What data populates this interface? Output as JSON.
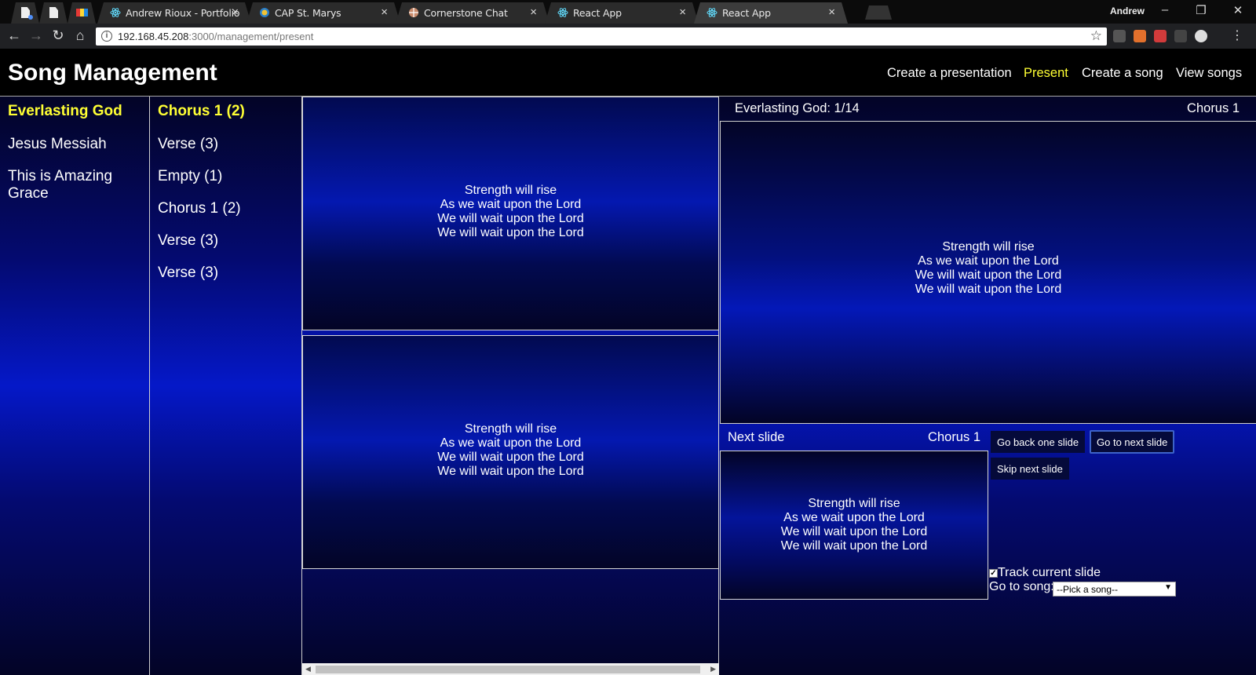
{
  "browser": {
    "tabs": [
      {
        "title": "Andrew Rioux - Portfolio",
        "close": "×"
      },
      {
        "title": "CAP St. Marys",
        "close": "×"
      },
      {
        "title": "Cornerstone Chat",
        "close": "×"
      },
      {
        "title": "React App",
        "close": "×"
      },
      {
        "title": "React App",
        "close": "×"
      }
    ],
    "profile_name": "Andrew",
    "url_host": "192.168.45.208",
    "url_path": ":3000/management/present"
  },
  "app": {
    "title": "Song Management",
    "nav": [
      {
        "label": "Create a presentation"
      },
      {
        "label": "Present",
        "active": true
      },
      {
        "label": "Create a song"
      },
      {
        "label": "View songs"
      }
    ]
  },
  "songs": [
    {
      "label": "Everlasting God",
      "active": true
    },
    {
      "label": "Jesus Messiah"
    },
    {
      "label": "This is Amazing Grace"
    }
  ],
  "sections": [
    {
      "label": "Chorus 1 (2)",
      "active": true
    },
    {
      "label": "Verse (3)"
    },
    {
      "label": "Empty (1)"
    },
    {
      "label": "Chorus 1 (2)"
    },
    {
      "label": "Verse (3)"
    },
    {
      "label": "Verse (3)"
    }
  ],
  "slides": [
    {
      "lines": [
        "Strength will rise",
        "As we wait upon the Lord",
        "We will wait upon the Lord",
        "We will wait upon the Lord"
      ]
    },
    {
      "lines": [
        "Strength will rise",
        "As we wait upon the Lord",
        "We will wait upon the Lord",
        "We will wait upon the Lord"
      ]
    }
  ],
  "current": {
    "song_position": "Everlasting God: 1/14",
    "section": "Chorus 1",
    "lines": [
      "Strength will rise",
      "As we wait upon the Lord",
      "We will wait upon the Lord",
      "We will wait upon the Lord"
    ]
  },
  "next": {
    "label": "Next slide",
    "section": "Chorus 1",
    "lines": [
      "Strength will rise",
      "As we wait upon the Lord",
      "We will wait upon the Lord",
      "We will wait upon the Lord"
    ]
  },
  "controls": {
    "back_label": "Go back one slide",
    "next_label": "Go to next slide",
    "skip_label": "Skip next slide",
    "track_label": "Track current slide",
    "track_checked": true,
    "goto_label": "Go to song:",
    "goto_value": "--Pick a song--"
  },
  "colors": {
    "accent": "#ffff33",
    "background_dark": "#030426",
    "background_bright": "#0518c8"
  }
}
